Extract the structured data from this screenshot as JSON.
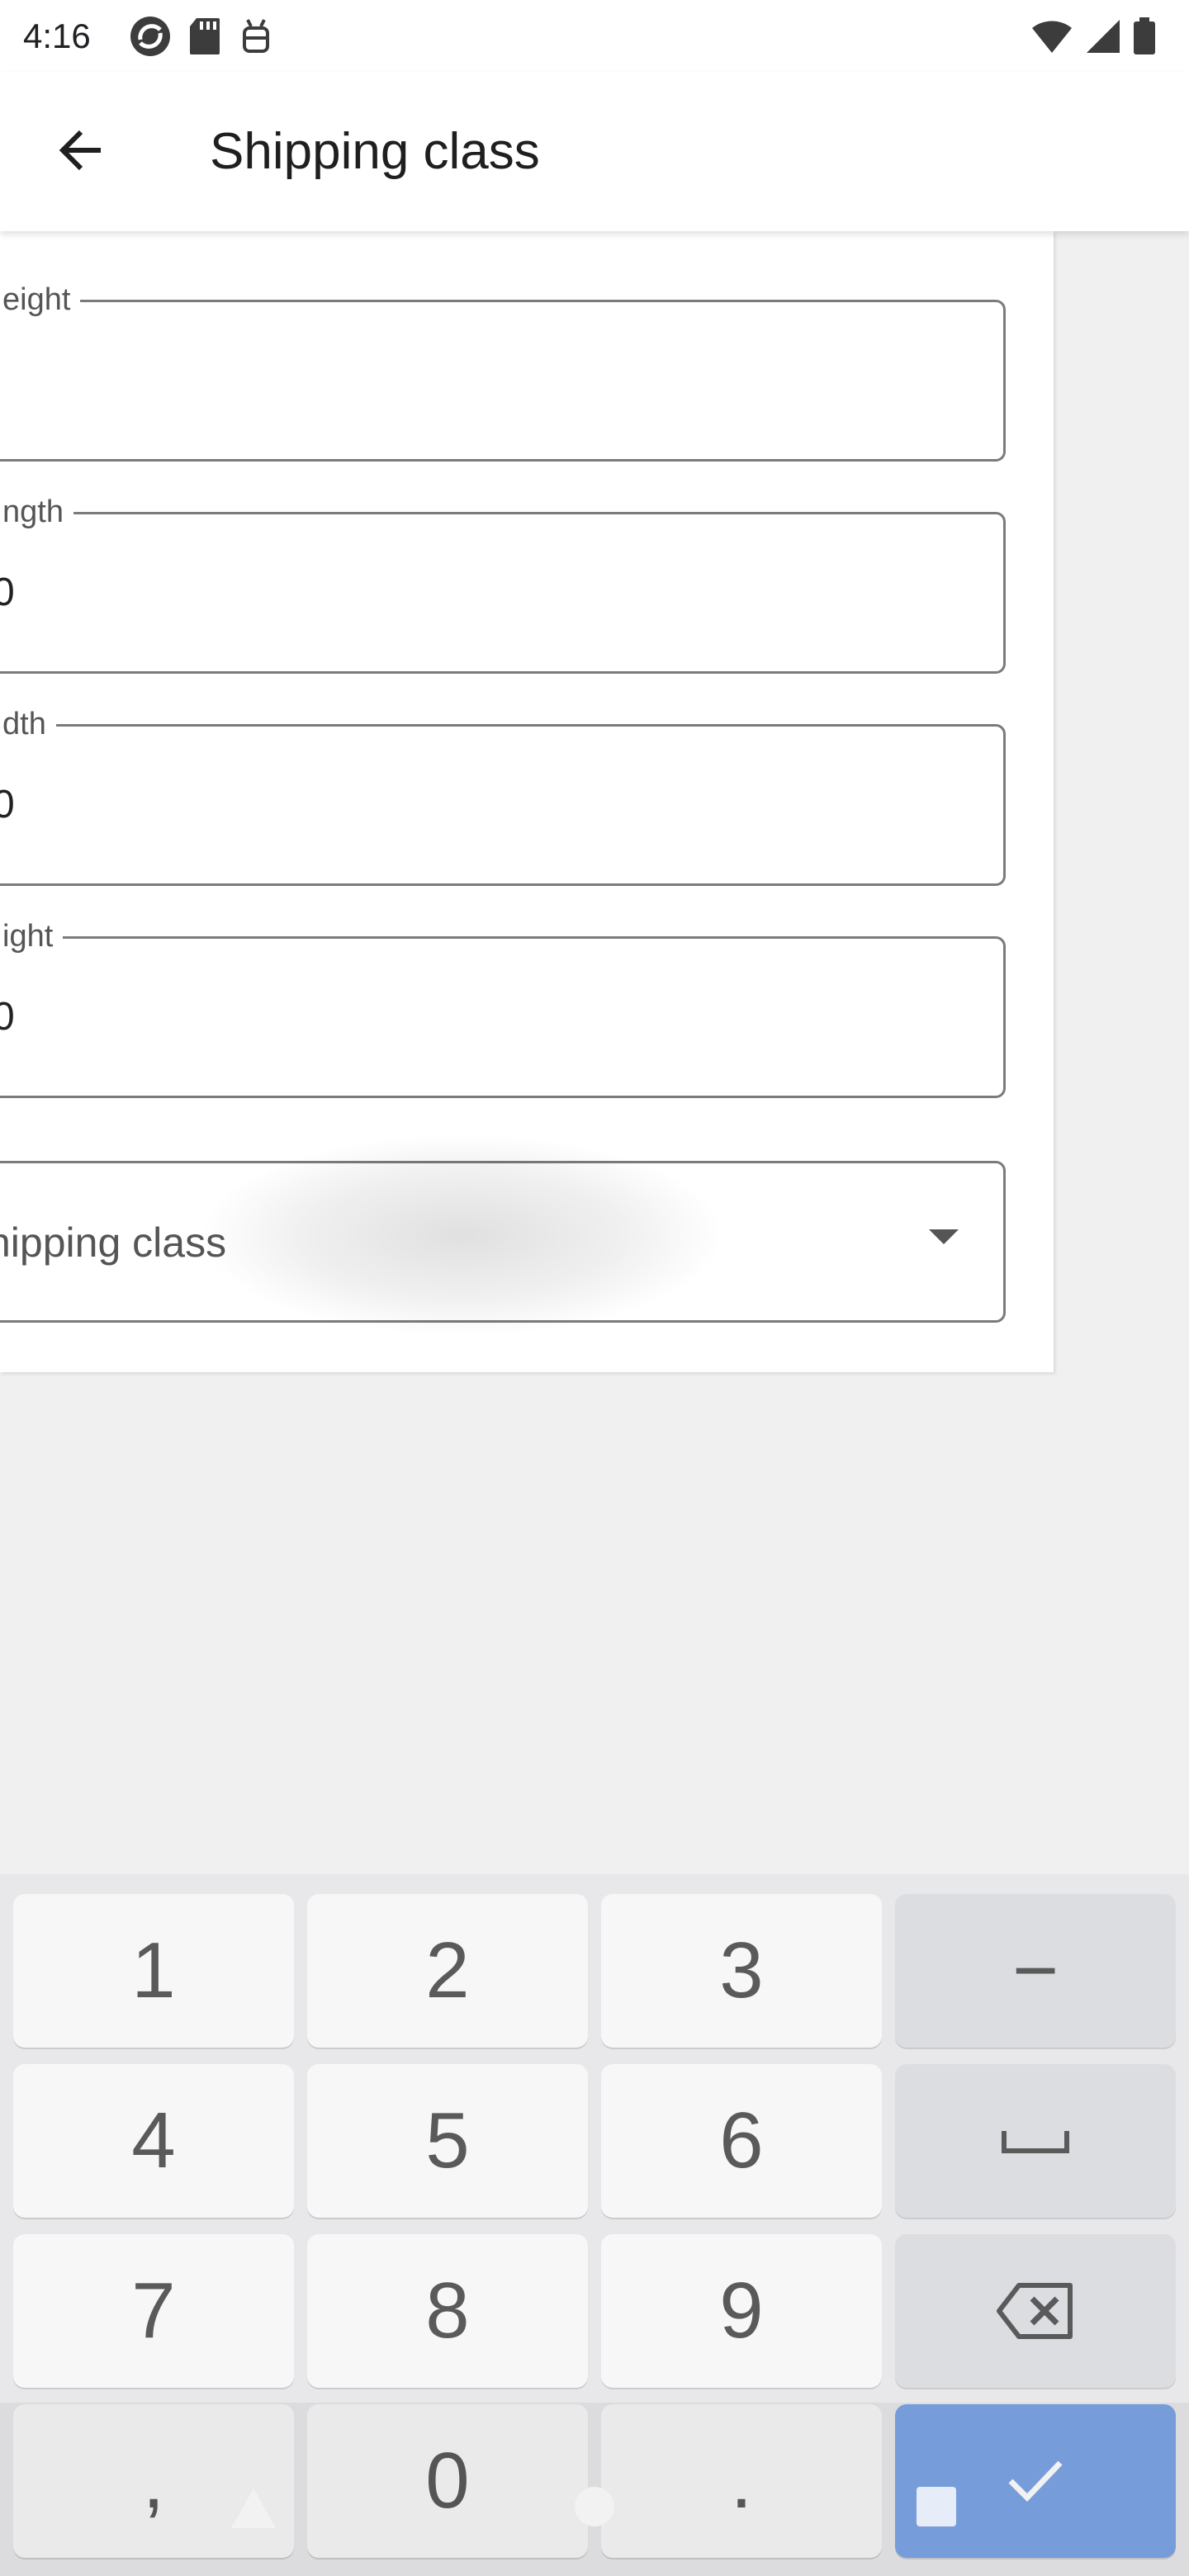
{
  "status_bar": {
    "time": "4:16",
    "left_icons": [
      "sync-app-icon",
      "sd-card-icon",
      "android-debug-icon"
    ],
    "right_icons": [
      "wifi-icon",
      "cell-signal-icon",
      "battery-icon"
    ]
  },
  "app_bar": {
    "back_icon": "arrow-left-icon",
    "title": "Shipping class"
  },
  "form": {
    "weight": {
      "label": "eight",
      "value": ""
    },
    "length": {
      "label": "ngth",
      "value": "0"
    },
    "width": {
      "label": "dth",
      "value": "0"
    },
    "height": {
      "label": "ight",
      "value": "0"
    },
    "shipping_class": {
      "placeholder": "hipping class",
      "caret_icon": "dropdown-caret-icon"
    }
  },
  "keyboard": {
    "rows": [
      [
        "1",
        "2",
        "3",
        "−"
      ],
      [
        "4",
        "5",
        "6",
        "space-icon"
      ],
      [
        "7",
        "8",
        "9",
        "backspace-icon"
      ],
      [
        ",",
        "0",
        ".",
        "check-icon"
      ]
    ],
    "colors": {
      "key": "#f7f7f7",
      "function_key": "#dcdde1",
      "enter_key": "#7ea5e6"
    }
  }
}
